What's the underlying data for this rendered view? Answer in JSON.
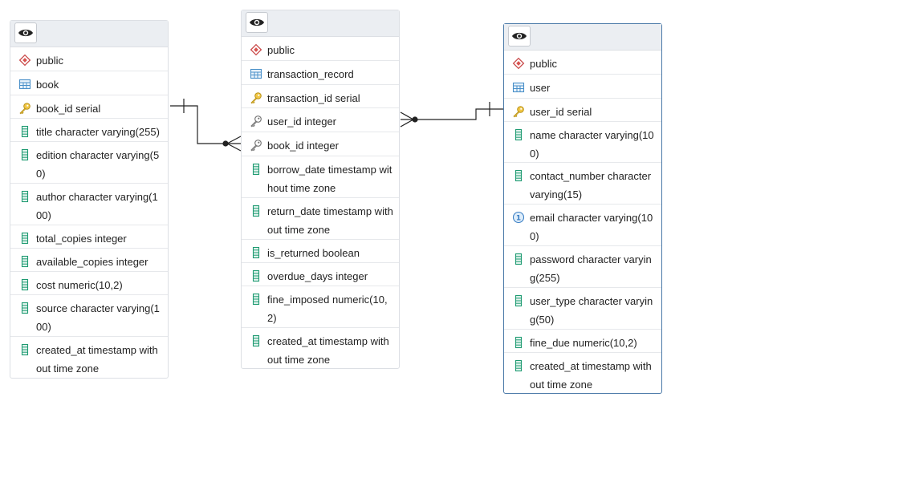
{
  "tables": [
    {
      "id": "book",
      "rows": [
        {
          "icon": "schema-icon",
          "text": "public"
        },
        {
          "icon": "table-icon",
          "text": "book"
        },
        {
          "icon": "primary-key-icon",
          "text": "book_id serial"
        },
        {
          "icon": "column-icon",
          "text": "title character varying(255)"
        },
        {
          "icon": "column-icon",
          "text": "edition character varying(50)"
        },
        {
          "icon": "column-icon",
          "text": "author character varying(100)"
        },
        {
          "icon": "column-icon",
          "text": "total_copies integer"
        },
        {
          "icon": "column-icon",
          "text": "available_copies integer"
        },
        {
          "icon": "column-icon",
          "text": "cost numeric(10,2)"
        },
        {
          "icon": "column-icon",
          "text": "source character varying(100)"
        },
        {
          "icon": "column-icon",
          "text": "created_at timestamp without time zone"
        }
      ]
    },
    {
      "id": "transaction_record",
      "rows": [
        {
          "icon": "schema-icon",
          "text": "public"
        },
        {
          "icon": "table-icon",
          "text": "transaction_record"
        },
        {
          "icon": "primary-key-icon",
          "text": "transaction_id serial"
        },
        {
          "icon": "foreign-key-icon",
          "text": "user_id integer"
        },
        {
          "icon": "foreign-key-icon",
          "text": "book_id integer"
        },
        {
          "icon": "column-icon",
          "text": "borrow_date timestamp without time zone"
        },
        {
          "icon": "column-icon",
          "text": "return_date timestamp without time zone"
        },
        {
          "icon": "column-icon",
          "text": "is_returned boolean"
        },
        {
          "icon": "column-icon",
          "text": "overdue_days integer"
        },
        {
          "icon": "column-icon",
          "text": "fine_imposed numeric(10,2)"
        },
        {
          "icon": "column-icon",
          "text": "created_at timestamp without time zone"
        }
      ]
    },
    {
      "id": "user",
      "rows": [
        {
          "icon": "schema-icon",
          "text": "public"
        },
        {
          "icon": "table-icon",
          "text": "user"
        },
        {
          "icon": "primary-key-icon",
          "text": "user_id serial"
        },
        {
          "icon": "column-icon",
          "text": "name character varying(100)"
        },
        {
          "icon": "column-icon",
          "text": "contact_number character varying(15)"
        },
        {
          "icon": "unique-key-icon",
          "text": "email character varying(100)"
        },
        {
          "icon": "column-icon",
          "text": "password character varying(255)"
        },
        {
          "icon": "column-icon",
          "text": "user_type character varying(50)"
        },
        {
          "icon": "column-icon",
          "text": "fine_due numeric(10,2)"
        },
        {
          "icon": "column-icon",
          "text": "created_at timestamp without time zone"
        }
      ]
    }
  ],
  "relationships": [
    {
      "from": "book.book_id",
      "to": "transaction_record.book_id",
      "type": "one-to-many"
    },
    {
      "from": "user.user_id",
      "to": "transaction_record.user_id",
      "type": "one-to-many"
    }
  ]
}
